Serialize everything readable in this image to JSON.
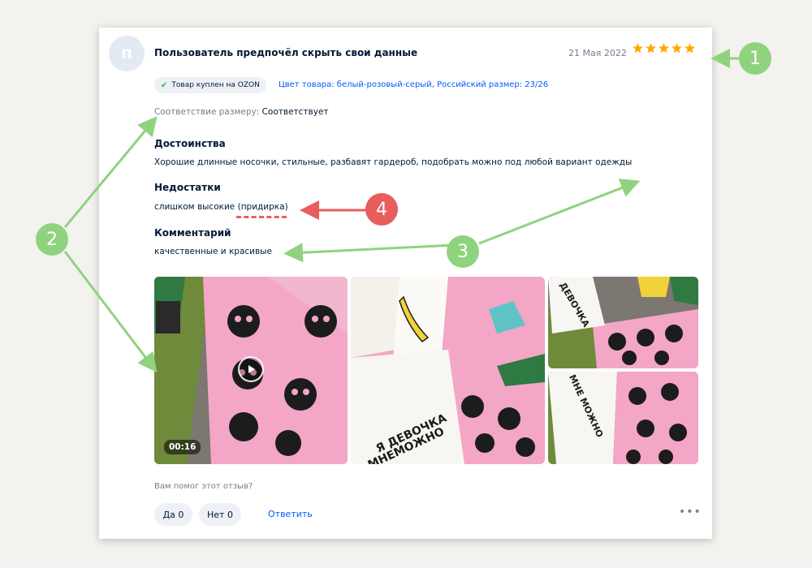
{
  "review": {
    "avatar_letter": "П",
    "username": "Пользователь предпочёл скрыть свои данные",
    "date": "21 Мая 2022",
    "rating": 5,
    "badge": "Товар куплен на OZON",
    "variant": "Цвет товара: белый-розовый-серый, Российский размер: 23/26",
    "size_label": "Соответствие размеру:",
    "size_value": "Соответствует",
    "pros_title": "Достоинства",
    "pros_text": "Хорошие длинные носочки, стильные, разбавят гардероб, подобрать можно под любой вариант одежды",
    "cons_title": "Недостатки",
    "cons_text_main": "слишком высокие",
    "cons_text_note": "(придирка)",
    "comment_title": "Комментарий",
    "comment_text": "качественные и красивые",
    "video_duration": "00:16",
    "helpful_question": "Вам помог этот отзыв?",
    "yes_label": "Да 0",
    "no_label": "Нет 0",
    "reply_label": "Ответить",
    "more_label": "•••"
  },
  "photos": {
    "sock_text_1": "Я ДЕВОЧКА",
    "sock_text_2": "МНЕМОЖНО",
    "sock_text_3": "ДЕВОЧКА",
    "sock_text_4": "МНЕ МОЖНО"
  },
  "annotations": {
    "callout_1": "1",
    "callout_2": "2",
    "callout_3": "3",
    "callout_4": "4"
  },
  "colors": {
    "accent_blue": "#005bff",
    "star": "#ffa800",
    "callout_green": "#8fd37f",
    "callout_red": "#e85d5d"
  }
}
